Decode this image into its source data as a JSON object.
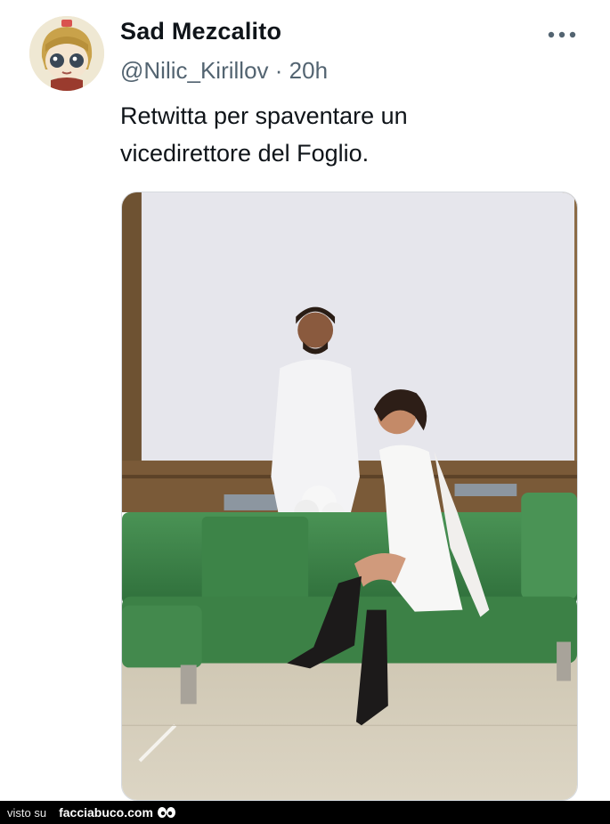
{
  "tweet": {
    "author": {
      "display_name": "Sad Mezcalito",
      "handle": "@Nilic_Kirillov",
      "separator": "·",
      "time": "20h"
    },
    "text_lines": [
      "Retwitta per spaventare un",
      "vicedirettore del Foglio."
    ],
    "more_icon": "more-dots-icon",
    "media_icon": "photo"
  },
  "footer": {
    "label": "visto su",
    "site": "facciabuco.com",
    "logo_icon": "eyes-logo-icon"
  },
  "colors": {
    "text_primary": "#0f1419",
    "text_secondary": "#536471",
    "sofa_green": "#3f8a4a",
    "footer_bg": "#000000"
  }
}
